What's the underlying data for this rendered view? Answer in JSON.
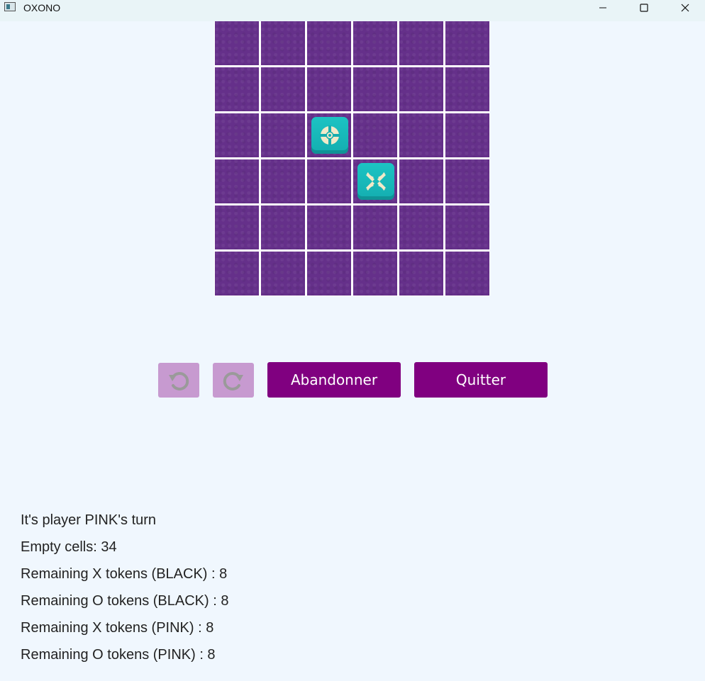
{
  "window": {
    "title": "OXONO",
    "icon": "app-icon",
    "controls": [
      "minimize-icon",
      "maximize-icon",
      "close-icon"
    ]
  },
  "board": {
    "rows": 6,
    "cols": 6,
    "cell_color": "#65308a",
    "tokens": [
      {
        "row": 2,
        "col": 2,
        "type": "O-totem",
        "color": "#1cc3c3"
      },
      {
        "row": 3,
        "col": 3,
        "type": "X-totem",
        "color": "#1cc3c3"
      }
    ]
  },
  "controls": {
    "undo_icon": "undo-icon",
    "redo_icon": "redo-icon",
    "abandon_label": "Abandonner",
    "quit_label": "Quitter",
    "button_color": "#800080",
    "disabled_icon_button_color": "#c79ad0"
  },
  "status": {
    "turn": "It's player PINK's turn",
    "empty_cells": "Empty cells: 34",
    "x_black": "Remaining X tokens (BLACK) : 8",
    "o_black": "Remaining O tokens (BLACK) : 8",
    "x_pink": "Remaining X tokens (PINK) : 8",
    "o_pink": "Remaining O tokens (PINK) : 8"
  }
}
